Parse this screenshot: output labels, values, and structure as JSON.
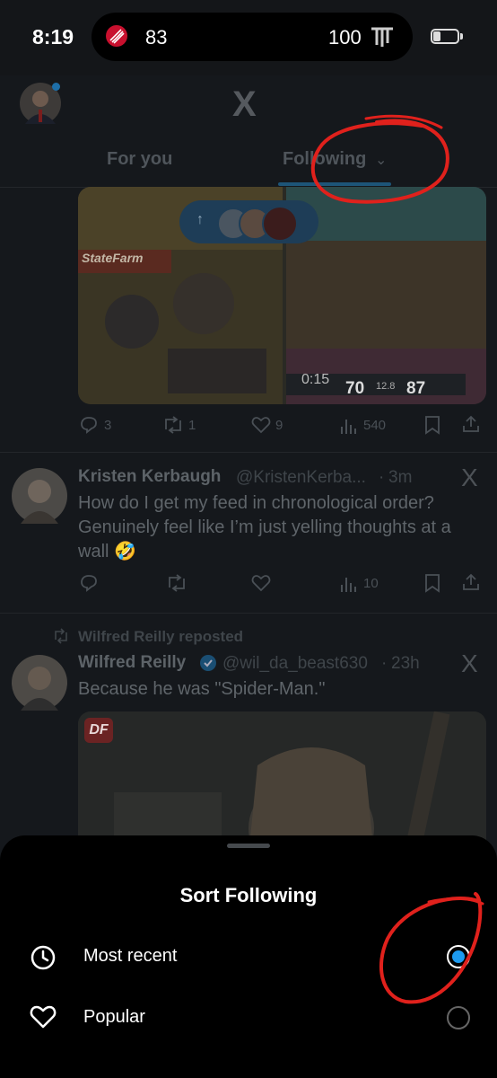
{
  "status_bar": {
    "time": "8:19",
    "score_left": "83",
    "score_right": "100"
  },
  "header": {
    "logo": "X",
    "tabs": [
      {
        "label": "For you",
        "active": false
      },
      {
        "label": "Following",
        "active": true
      }
    ]
  },
  "posts": [
    {
      "type": "media",
      "media": {
        "left_banner": "StateFarm",
        "game_clock": "0:15",
        "score_a": "70",
        "score_b": "87",
        "shot_clock": "12.8"
      },
      "actions": {
        "replies": "3",
        "reposts": "1",
        "likes": "9",
        "views": "540"
      }
    },
    {
      "name": "Kristen Kerbaugh",
      "handle": "@KristenKerba...",
      "time": "3m",
      "text": "How do I get my feed in chronological order? Genuinely feel like I’m just yelling thoughts at a wall 🤣",
      "actions": {
        "replies": "",
        "reposts": "",
        "likes": "",
        "views": "10"
      }
    },
    {
      "repost_label": "Wilfred Reilly reposted",
      "name": "Wilfred Reilly",
      "handle": "@wil_da_beast630",
      "time": "23h",
      "text": "Because he was \"Spider-Man.\"",
      "media_badge": "DF"
    }
  ],
  "new_posts_pill": {
    "arrow": "↑"
  },
  "sort_sheet": {
    "title": "Sort Following",
    "options": [
      {
        "label": "Most recent",
        "icon": "clock-icon",
        "selected": true
      },
      {
        "label": "Popular",
        "icon": "heart-icon",
        "selected": false
      }
    ]
  },
  "colors": {
    "accent": "#1d9bf0",
    "annotation": "#e0211c",
    "team_left": "#c8102e"
  }
}
